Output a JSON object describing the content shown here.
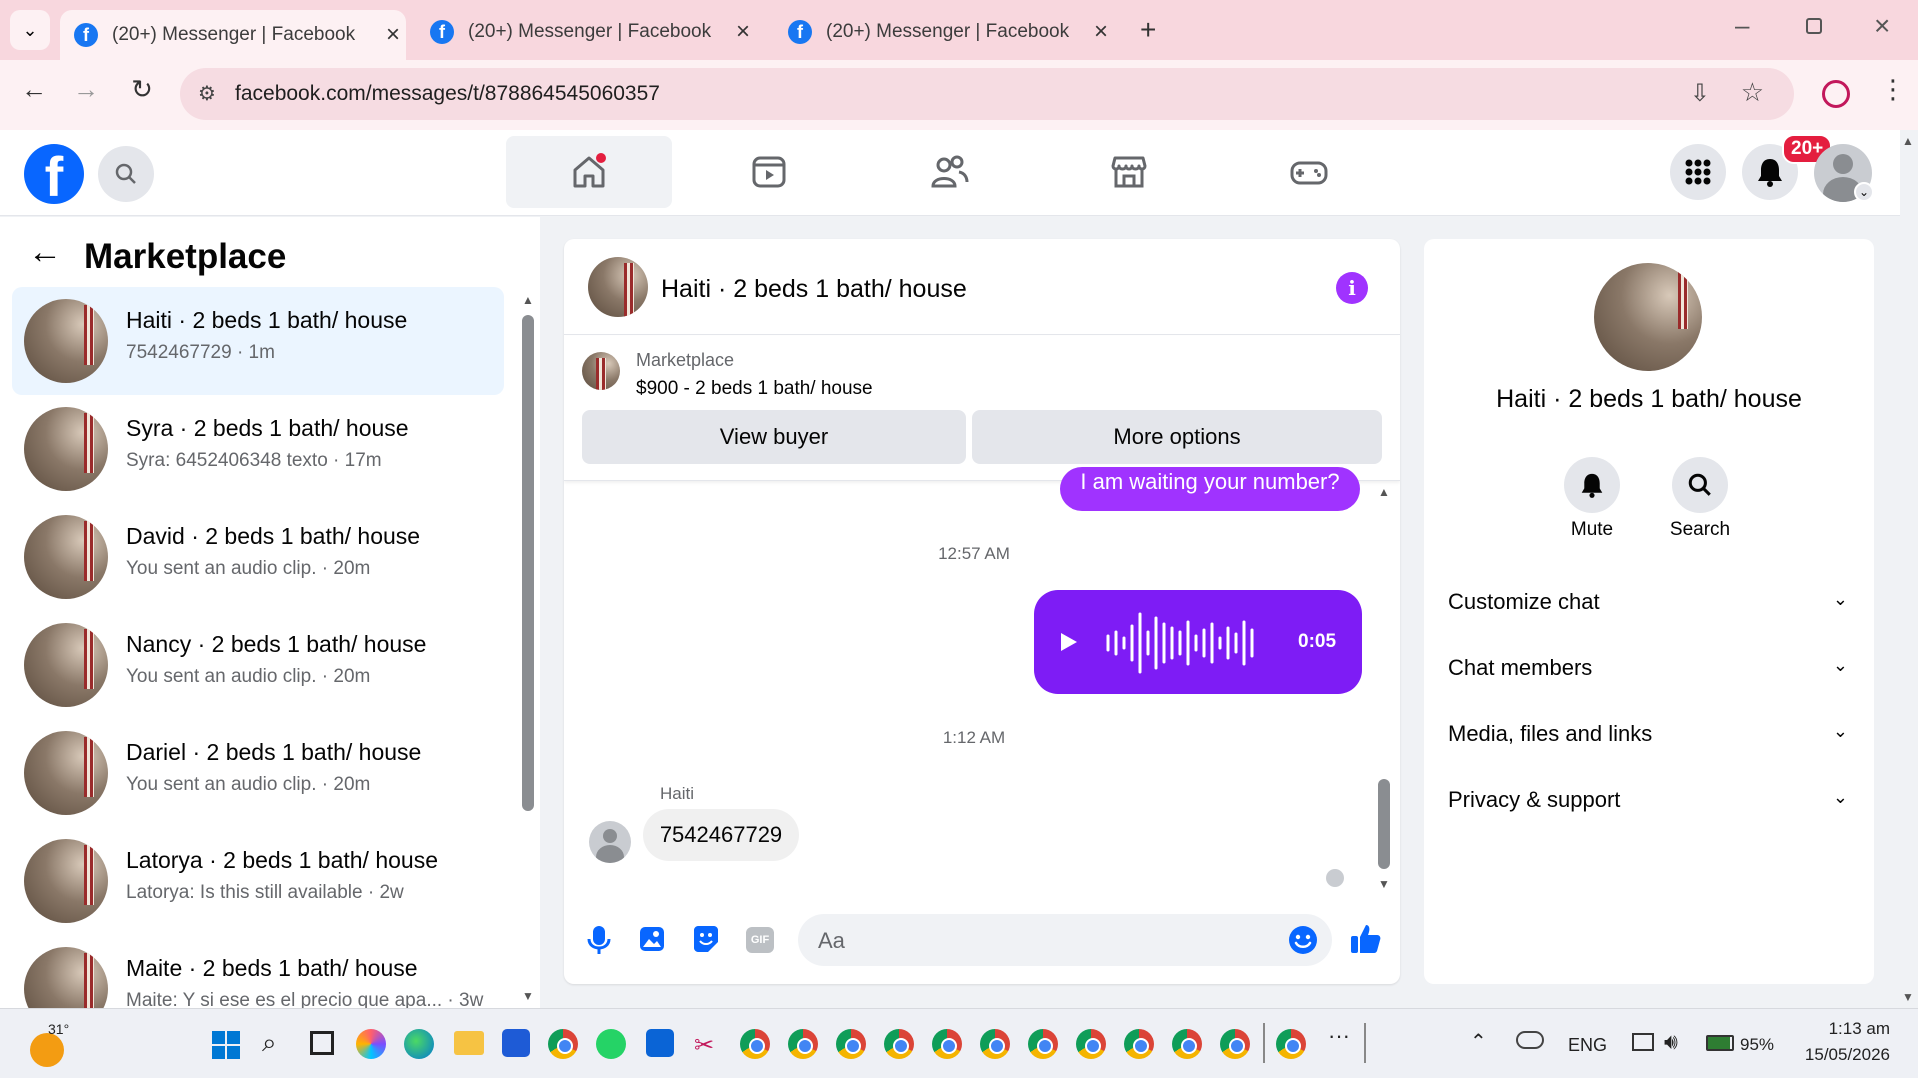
{
  "browser": {
    "tabs": [
      {
        "title": "(20+) Messenger | Facebook",
        "active": true
      },
      {
        "title": "(20+) Messenger | Facebook",
        "active": false
      },
      {
        "title": "(20+) Messenger | Facebook",
        "active": false
      }
    ],
    "url": "facebook.com/messages/t/878864545060357"
  },
  "header": {
    "notification_badge": "20+"
  },
  "left_panel": {
    "title": "Marketplace",
    "conversations": [
      {
        "name": "Haiti · 2 beds 1 bath/ house",
        "subtitle": "7542467729 · 1m",
        "selected": true
      },
      {
        "name": "Syra · 2 beds 1 bath/ house",
        "subtitle": "Syra: 6452406348 texto · 17m"
      },
      {
        "name": "David · 2 beds 1 bath/ house",
        "subtitle": "You sent an audio clip. · 20m"
      },
      {
        "name": "Nancy · 2 beds 1 bath/ house",
        "subtitle": "You sent an audio clip. · 20m"
      },
      {
        "name": "Dariel · 2 beds 1 bath/ house",
        "subtitle": "You sent an audio clip. · 20m"
      },
      {
        "name": "Latorya · 2 beds 1 bath/ house",
        "subtitle": "Latorya: Is this still available · 2w"
      },
      {
        "name": "Maite · 2 beds 1 bath/ house",
        "subtitle": "Maite: Y si ese es el precio que apa... · 3w"
      }
    ]
  },
  "chat": {
    "title": "Haiti · 2 beds 1 bath/ house",
    "listing_label": "Marketplace",
    "listing_detail": "$900 - 2 beds 1 bath/ house",
    "view_buyer": "View buyer",
    "more_options": "More options",
    "prev_message": "I am waiting your number?",
    "time1": "12:57 AM",
    "audio_duration": "0:05",
    "time2": "1:12 AM",
    "sender": "Haiti",
    "incoming_message": "7542467729",
    "composer_placeholder": "Aa"
  },
  "right_panel": {
    "title": "Haiti · 2 beds 1 bath/ house",
    "mute": "Mute",
    "search": "Search",
    "sections": [
      "Customize chat",
      "Chat members",
      "Media, files and links",
      "Privacy & support"
    ]
  },
  "taskbar": {
    "weather": "31°",
    "language": "ENG",
    "battery": "95%",
    "time": "1:13 am",
    "date": "15/05/2026"
  },
  "colors": {
    "messenger_purple": "#7e1cf5",
    "fb_blue": "#0866ff",
    "tab_bar": "#f8d7de"
  }
}
